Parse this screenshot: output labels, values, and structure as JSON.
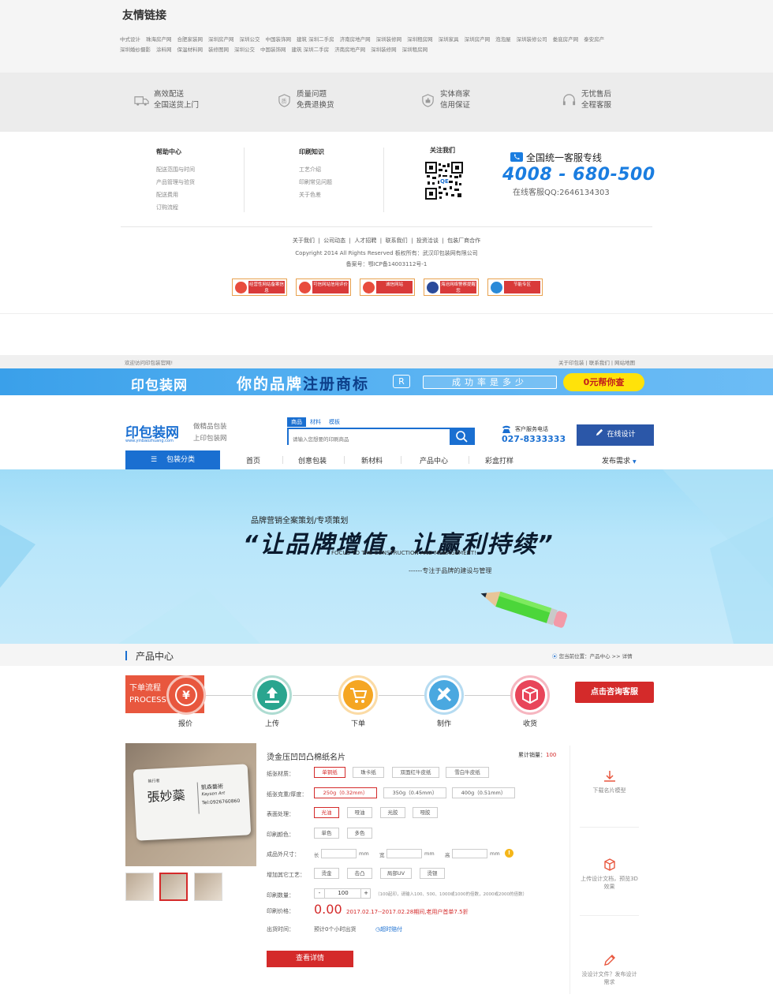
{
  "friend_links": {
    "title": "友情链接",
    "row1": [
      "中式设计",
      "珠海房产网",
      "合肥家装网",
      "深圳房产网",
      "深圳公交",
      "中国装饰网",
      "建筑 深圳二手房",
      "济南房地产网",
      "深圳装修网",
      "深圳租房网",
      "深圳家具",
      "深圳房产网",
      "泡泡屋",
      "深圳装修公司",
      "娄底房产网",
      "泰安房产"
    ],
    "row2": [
      "深圳婚纱摄影",
      "涂料网",
      "保温材料网",
      "装修图网",
      "深圳公交",
      "中国装饰网",
      "建筑 深圳二手房",
      "济南房地产网",
      "深圳装修网",
      "深圳租房网"
    ]
  },
  "features": [
    {
      "icon": "truck-icon",
      "line1": "高效配送",
      "line2": "全国送货上门"
    },
    {
      "icon": "quality-shield-icon",
      "line1": "质量问题",
      "line2": "免费退换货"
    },
    {
      "icon": "thumbs-up-shield-icon",
      "line1": "实体商家",
      "line2": "信用保证"
    },
    {
      "icon": "headset-icon",
      "line1": "无忧售后",
      "line2": "全程客服"
    }
  ],
  "help": {
    "title": "帮助中心",
    "items": [
      "配送范围与时间",
      "产品管理与验货",
      "配送费用",
      "订购流程"
    ]
  },
  "knowledge": {
    "title": "印刷知识",
    "items": [
      "工艺介绍",
      "印刷常见问题",
      "关于色差"
    ]
  },
  "follow": {
    "title": "关注我们"
  },
  "hotline": {
    "label": "全国统一客服专线",
    "number": "4008 - 680-500",
    "qq": "在线客服QQ:2646134303"
  },
  "bottom": {
    "links": [
      "关于我们",
      "公司动态",
      "人才招聘",
      "联系我们",
      "投资洽谈",
      "包装厂商合作"
    ],
    "copyright": "Copyright 2014 All Rights Reserved 板权所有：武汉印包装网有限公司",
    "icp": "备案号：鄂ICP备14003112号-1",
    "badges": [
      "经营性网站备案信息",
      "可信网站信用评价",
      "诚信网站",
      "海沧网络警察提醒您",
      "节能专区"
    ]
  },
  "topbar": {
    "welcome": "欢迎访问印包装官网!",
    "links": [
      "关于印包装",
      "联系我们",
      "网站地图"
    ]
  },
  "ad": {
    "logo": "印包装网",
    "main_a": "你的品牌",
    "main_b": "注册商标",
    "r": "R",
    "rate": "成功率是多少",
    "button": "0元帮你查"
  },
  "header": {
    "logo": "印包装网",
    "logo_sub": "www.yinbaozhuang.com",
    "slogan1": "做精品包装",
    "slogan2": "上印包装网",
    "search_tabs": [
      "商品",
      "材料",
      "模板"
    ],
    "search_placeholder": "请输入您想要的印刷商品",
    "phone_label": "客户服务电话",
    "phone": "027-8333333",
    "design": "在线设计"
  },
  "nav": {
    "category": "包装分类",
    "items": [
      "首页",
      "创意包装",
      "新材料",
      "产品中心",
      "彩盒打样"
    ],
    "publish": "发布需求"
  },
  "hero": {
    "t1": "品牌营销全案策划/专项策划",
    "t2": "“让品牌增值，让赢利持续”",
    "t3": "FOCUS TO THE CONSTRUCTION AND MANAGEMENT!",
    "t4": "------专注于品牌的建设与管理"
  },
  "section": {
    "title": "产品中心",
    "breadcrumb": "您当前位置：产品中心 >> 详情"
  },
  "process": {
    "label1": "下单流程",
    "label2": "PROCESS",
    "steps": [
      {
        "label": "报价",
        "color": "#e8573e",
        "icon": "yen-icon"
      },
      {
        "label": "上传",
        "color": "#2aa58f",
        "icon": "upload-icon"
      },
      {
        "label": "下单",
        "color": "#f5a623",
        "icon": "cart-icon"
      },
      {
        "label": "制作",
        "color": "#4aa8e0",
        "icon": "pencil-ruler-icon"
      },
      {
        "label": "收货",
        "color": "#e8455a",
        "icon": "box-icon"
      }
    ],
    "consult": "点击咨询客服"
  },
  "product": {
    "title": "烫金压凹凹凸棉纸名片",
    "sales_label": "累计销量：",
    "sales": "100",
    "card_title": "執行者",
    "card_name": "張妙蘂",
    "card_company": "凱森藝術",
    "card_company_en": "Kaysen Art",
    "card_tel": "Tel:0926760860",
    "material_label": "纸张材质：",
    "materials": [
      "单铜纸",
      "珠卡纸",
      "双面红牛皮纸",
      "雪白牛皮纸"
    ],
    "weight_label": "纸张克重/厚度：",
    "weights": [
      "250g（0.32mm）",
      "350g（0.45mm）",
      "400g（0.51mm）"
    ],
    "surface_label": "表面处理：",
    "surfaces": [
      "光油",
      "哑油",
      "光胶",
      "哑胶"
    ],
    "color_label": "印刷颜色：",
    "colors": [
      "单色",
      "多色"
    ],
    "size_label": "成品外尺寸：",
    "len": "长",
    "wid": "宽",
    "hei": "高",
    "unit": "mm",
    "craft_label": "增加其它工艺：",
    "crafts": [
      "烫金",
      "击凸",
      "局部UV",
      "烫银"
    ],
    "qty_label": "印刷数量：",
    "qty": "100",
    "qty_minus": "-",
    "qty_plus": "+",
    "qty_note": "（100起印，请输入100、500、1000或1000的倍数，2000或2000的倍数）",
    "price_label": "印刷价格：",
    "price": "0.00",
    "price_note": "2017.02.17--2017.02.28期间,老用户首单7.5折",
    "delivery_label": "出货时间：",
    "delivery": "预计0个小时出货",
    "delivery_link": "超时赔付",
    "detail": "查看详情"
  },
  "tools": [
    {
      "icon": "download-icon",
      "text": "下载名片模型"
    },
    {
      "icon": "cube-icon",
      "text": "上传设计文档，预览3D效果"
    },
    {
      "icon": "pen-icon",
      "text": "没设计文件？发布设计需求"
    }
  ]
}
